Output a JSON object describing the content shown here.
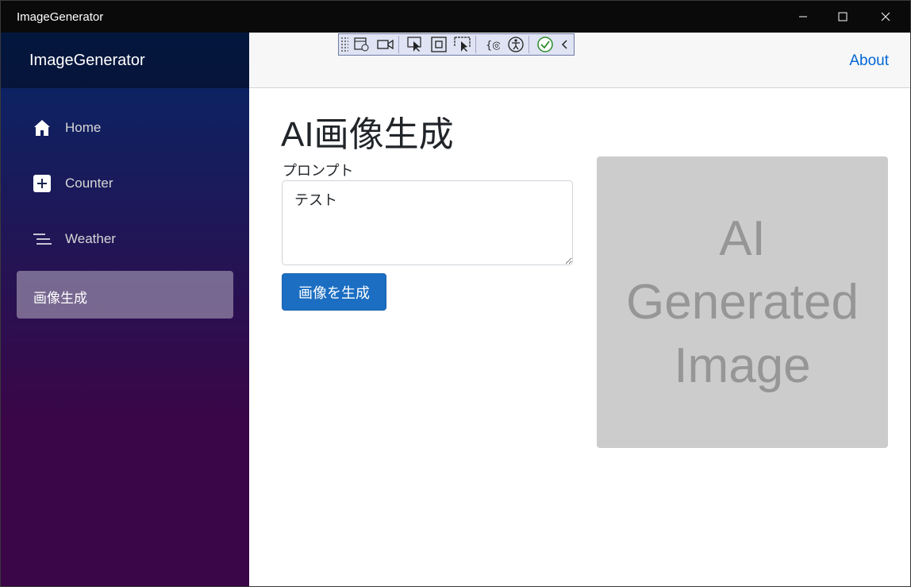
{
  "window": {
    "title": "ImageGenerator"
  },
  "sidebar": {
    "brand": "ImageGenerator",
    "items": [
      {
        "label": "Home",
        "icon": "home-icon"
      },
      {
        "label": "Counter",
        "icon": "plus-square-icon"
      },
      {
        "label": "Weather",
        "icon": "list-icon"
      },
      {
        "label": "画像生成",
        "icon": "",
        "active": true
      }
    ]
  },
  "topbar": {
    "about": "About"
  },
  "page": {
    "title": "AI画像生成",
    "prompt_label": "プロンプト",
    "prompt_value": "テスト",
    "generate_button": "画像を生成",
    "image_placeholder": "AI\nGenerated\nImage"
  },
  "colors": {
    "accent": "#1b6ec2",
    "link": "#0366d6",
    "sidebar_top": "#052767",
    "sidebar_bottom": "#3a0647"
  }
}
